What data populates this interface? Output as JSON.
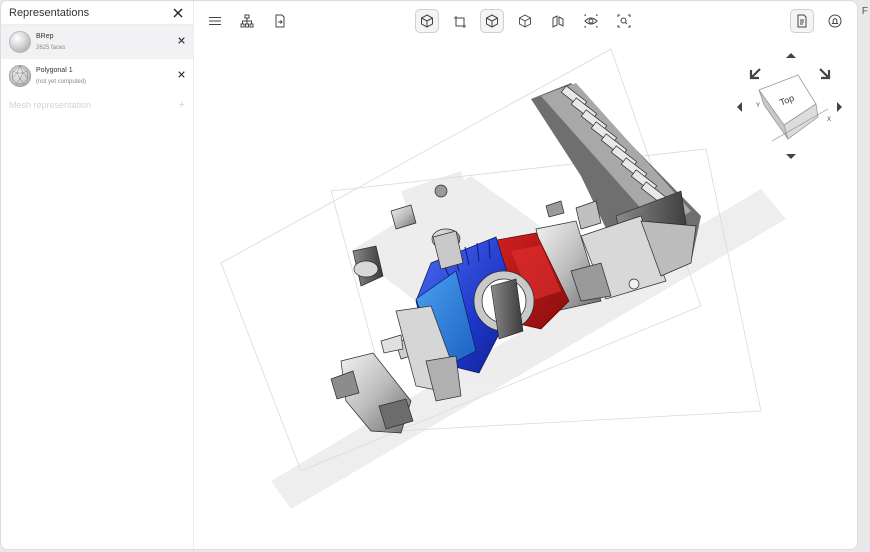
{
  "panel": {
    "title": "Representations",
    "items": [
      {
        "name": "BRep",
        "sub": "2625 faces",
        "thumb": "sphere"
      },
      {
        "name": "Polygonal 1",
        "sub": "(not yet computed)",
        "thumb": "mesh-sphere"
      }
    ],
    "mesh_label": "Mesh representation",
    "mesh_add": "+"
  },
  "viewcube": {
    "face": "Top",
    "axis_x": "X",
    "axis_y": "Y"
  },
  "edge_text": "F",
  "colors": {
    "accent_blue": "#1f3ccf",
    "accent_red": "#c41a1a",
    "panel_bg": "#ffffff"
  }
}
